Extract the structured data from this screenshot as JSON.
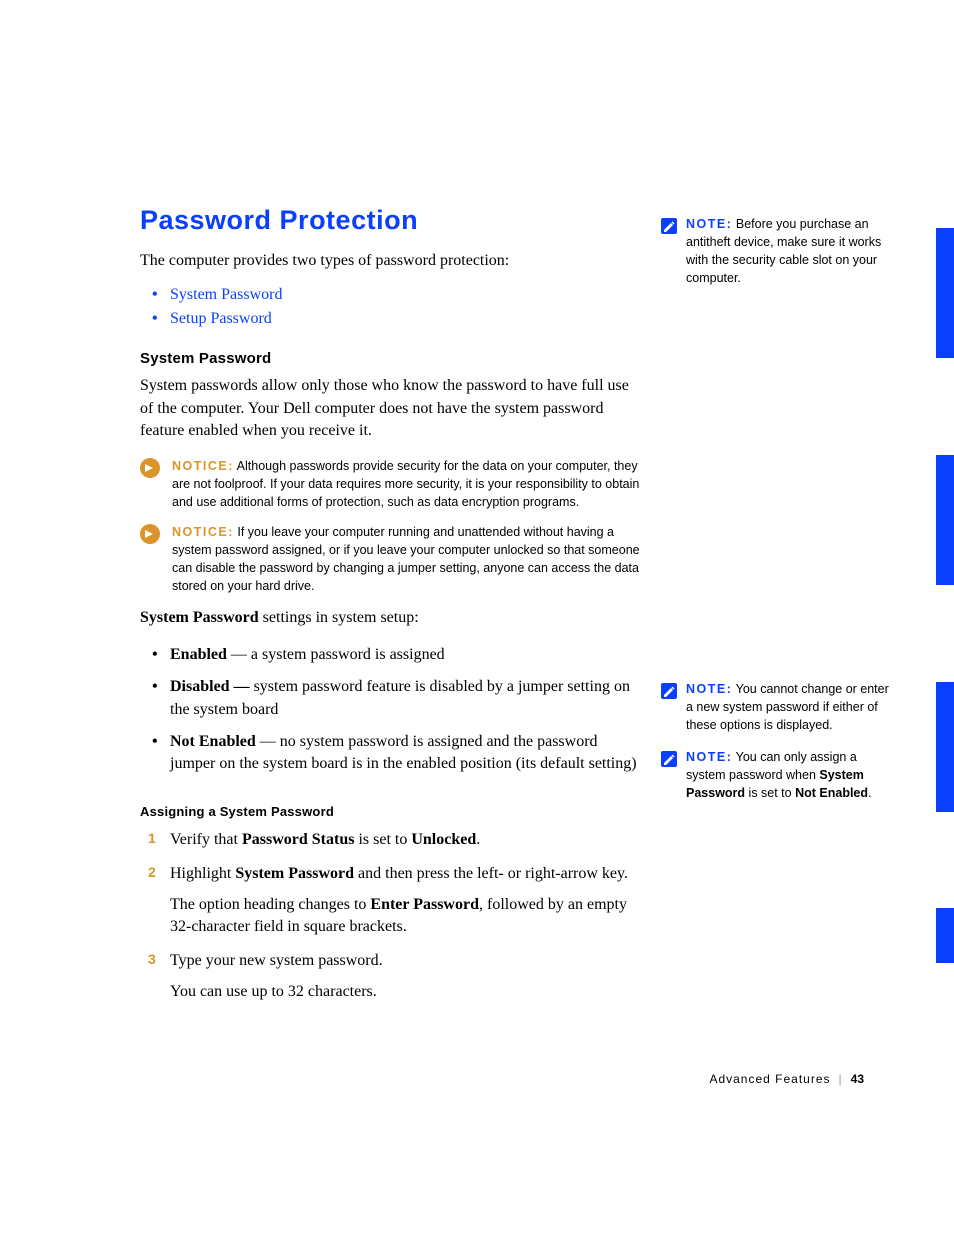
{
  "title": "Password Protection",
  "intro": "The computer provides two types of password protection:",
  "links": [
    "System Password",
    "Setup Password"
  ],
  "section1": {
    "heading": "System Password",
    "body": "System passwords allow only those who know the password to have full use of the computer. Your Dell computer does not have the system password feature enabled when you receive it."
  },
  "notices": [
    {
      "label": "NOTICE:",
      "text": " Although passwords provide security for the data on your computer, they are not foolproof. If your data requires more security, it is your responsibility to obtain and use additional forms of protection, such as data encryption programs."
    },
    {
      "label": "NOTICE:",
      "text": " If you leave your computer running and unattended without having a system password assigned, or if you leave your computer unlocked so that someone can disable the password by changing a jumper setting, anyone can access the data stored on your hard drive."
    }
  ],
  "settings_intro_bold": "System Password",
  "settings_intro_rest": " settings in system setup:",
  "settings": [
    {
      "term": "Enabled",
      "dash": " — ",
      "desc": "a system password is assigned"
    },
    {
      "term": "Disabled —",
      "dash": " ",
      "desc": "system password feature is disabled by a jumper setting on the system board"
    },
    {
      "term": "Not Enabled",
      "dash": " — ",
      "desc": "no system password is assigned and the password jumper on the system board is in the enabled position (its default setting)"
    }
  ],
  "assign": {
    "heading": "Assigning a System Password",
    "steps": [
      {
        "pre": "Verify that ",
        "b1": "Password Status",
        "mid": " is set to ",
        "b2": "Unlocked",
        "post": "."
      },
      {
        "pre": "Highlight ",
        "b1": "System Password",
        "mid": " and then press the left- or right-arrow key.",
        "b2": "",
        "post": "",
        "para_pre": "The option heading changes to ",
        "para_b": "Enter Password",
        "para_post": ", followed by an empty 32-character field in square brackets."
      },
      {
        "pre": "Type your new system password.",
        "b1": "",
        "mid": "",
        "b2": "",
        "post": "",
        "para_pre": "You can use up to 32 characters.",
        "para_b": "",
        "para_post": ""
      }
    ]
  },
  "notes": [
    {
      "label": "NOTE:",
      "text": " Before you purchase an antitheft device, make sure it works with the security cable slot on your computer."
    },
    {
      "label": "NOTE:",
      "text": " You cannot change or enter a new system password if either of these options is displayed."
    },
    {
      "label": "NOTE:",
      "pre": " You can only assign a system password when ",
      "b1": "System Password",
      "mid": " is set to ",
      "b2": "Not Enabled",
      "post": "."
    }
  ],
  "footer": {
    "section": "Advanced Features",
    "page": "43"
  }
}
